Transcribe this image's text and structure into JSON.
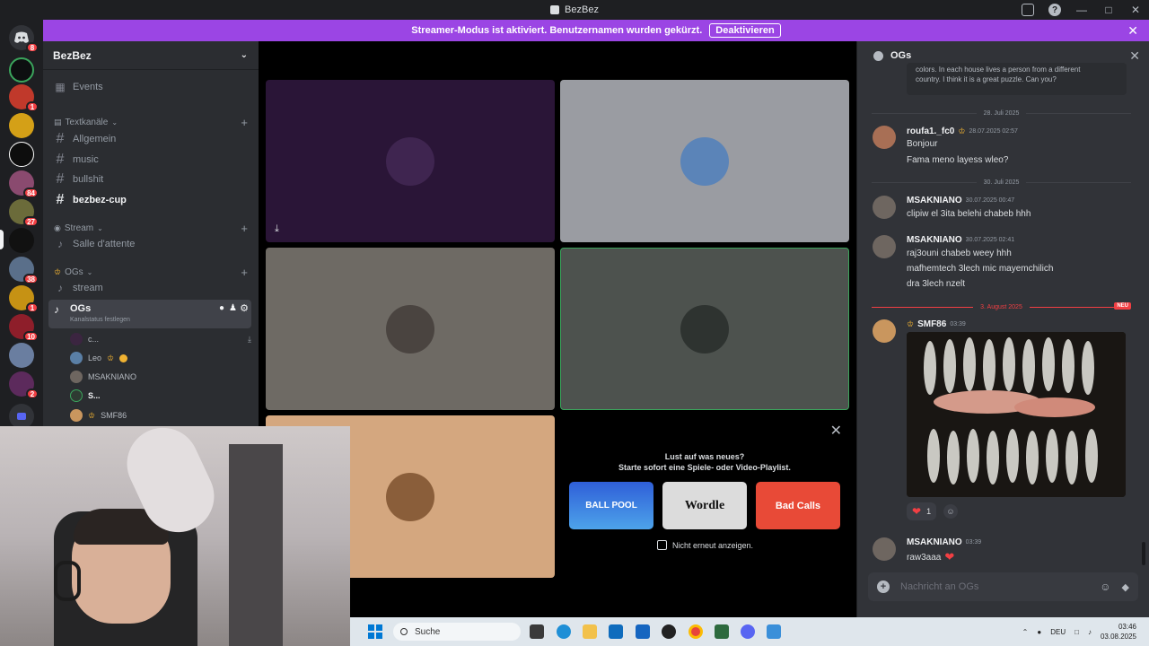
{
  "window": {
    "title": "BezBez"
  },
  "banner": {
    "text": "Streamer-Modus ist aktiviert. Benutzernamen wurden gekürzt.",
    "button": "Deaktivieren"
  },
  "rail": {
    "badges": [
      "8",
      "1",
      "84",
      "27",
      "38",
      "1",
      "10",
      "2"
    ]
  },
  "server": {
    "name": "BezBez"
  },
  "sidebar": {
    "events_label": "Events",
    "categories": [
      {
        "label": "Textkanäle"
      },
      {
        "label": "Stream"
      },
      {
        "label": "OGs"
      }
    ],
    "text_channels": [
      "Allgemein",
      "music",
      "bullshit",
      "bezbez-cup"
    ],
    "stream_channels": [
      "Salle d'attente"
    ],
    "og_channels": [
      "stream",
      "OGs"
    ],
    "og_status": "Kanalstatus festlegen",
    "members": [
      "c...",
      "Leo",
      "MSAKNIANO",
      "S...",
      "SMF86"
    ]
  },
  "promo": {
    "line1": "Lust auf was neues?",
    "line2": "Starte sofort eine Spiele- oder Video-Playlist.",
    "games": [
      "BALL POOL",
      "Wordle",
      "Bad Calls"
    ],
    "dont_show": "Nicht erneut anzeigen."
  },
  "chat": {
    "channel": "OGs",
    "top_text_1": "colors. In each house lives a person from a different",
    "top_text_2": "country. I think it is a great puzzle. Can you?",
    "dividers": {
      "d1": "28. Juli 2025",
      "d2": "30. Juli 2025",
      "d3": "3. August 2025",
      "new_tag": "NEU"
    },
    "m1": {
      "name": "roufa1._fc0",
      "time": "28.07.2025 02:57",
      "lines": [
        "Bonjour",
        "Fama meno layess wleo?"
      ]
    },
    "m2": {
      "name": "MSAKNIANO",
      "time": "30.07.2025 00:47",
      "lines": [
        "clipiw el 3ita belehi chabeb hhh"
      ]
    },
    "m3": {
      "name": "MSAKNIANO",
      "time": "30.07.2025 02:41",
      "lines": [
        "raj3ouni chabeb weey hhh",
        "mafhemtech 3lech mic mayemchilich",
        "dra 3lech nzelt"
      ]
    },
    "m4": {
      "name": "SMF86",
      "time": "03:39",
      "reaction_count": "1"
    },
    "m5": {
      "name": "MSAKNIANO",
      "time": "03:39",
      "lines": [
        "raw3aaa"
      ]
    },
    "input_placeholder": "Nachricht an OGs"
  },
  "taskbar": {
    "search": "Suche",
    "lang": "DEU",
    "time": "03:46",
    "date": "03.08.2025"
  },
  "colors": {
    "accent": "#9b45e4",
    "danger": "#f23f43",
    "bg": "#313338"
  }
}
